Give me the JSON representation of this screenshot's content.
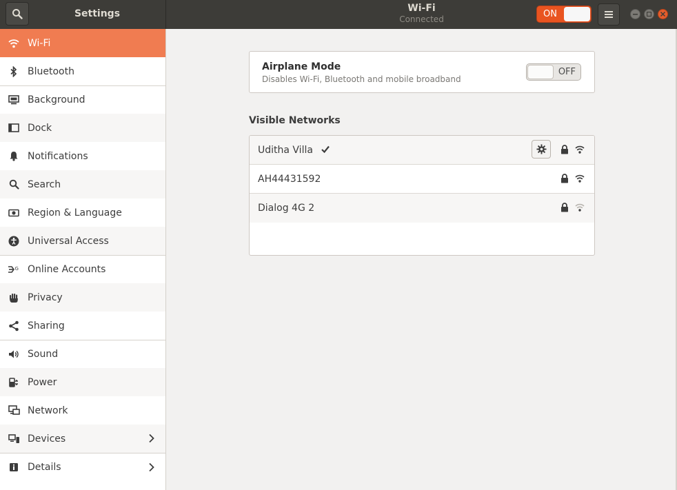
{
  "header": {
    "app_title": "Settings",
    "page_title": "Wi-Fi",
    "page_subtitle": "Connected",
    "master_toggle_label": "ON"
  },
  "sidebar": {
    "items": [
      {
        "label": "Wi-Fi",
        "icon": "wifi-icon",
        "selected": true
      },
      {
        "label": "Bluetooth",
        "icon": "bluetooth-icon"
      },
      {
        "label": "Background",
        "icon": "background-icon"
      },
      {
        "label": "Dock",
        "icon": "dock-icon"
      },
      {
        "label": "Notifications",
        "icon": "bell-icon"
      },
      {
        "label": "Search",
        "icon": "search-icon"
      },
      {
        "label": "Region & Language",
        "icon": "region-icon"
      },
      {
        "label": "Universal Access",
        "icon": "accessibility-icon"
      },
      {
        "label": "Online Accounts",
        "icon": "online-accounts-icon"
      },
      {
        "label": "Privacy",
        "icon": "hand-icon"
      },
      {
        "label": "Sharing",
        "icon": "share-icon"
      },
      {
        "label": "Sound",
        "icon": "speaker-icon"
      },
      {
        "label": "Power",
        "icon": "power-plug-icon"
      },
      {
        "label": "Network",
        "icon": "network-icon"
      },
      {
        "label": "Devices",
        "icon": "devices-icon",
        "chevron": true
      },
      {
        "label": "Details",
        "icon": "info-icon",
        "chevron": true
      }
    ]
  },
  "airplane": {
    "title": "Airplane Mode",
    "subtitle": "Disables Wi-Fi, Bluetooth and mobile broadband",
    "toggle_label": "OFF"
  },
  "networks": {
    "section_title": "Visible Networks",
    "items": [
      {
        "name": "Uditha Villa",
        "connected": true,
        "secured": true,
        "signal": "strong"
      },
      {
        "name": "AH44431592",
        "connected": false,
        "secured": true,
        "signal": "strong"
      },
      {
        "name": "Dialog 4G 2",
        "connected": false,
        "secured": true,
        "signal": "weak"
      }
    ]
  },
  "colors": {
    "accent": "#e95420",
    "selected_row": "#f07c51",
    "headerbar": "#3d3c38"
  }
}
